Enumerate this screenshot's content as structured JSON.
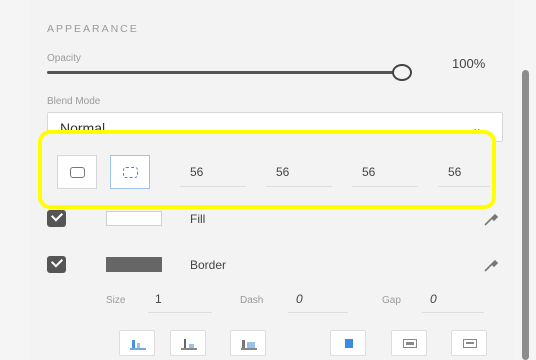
{
  "appearance": {
    "section_title": "APPEARANCE",
    "opacity": {
      "label": "Opacity",
      "value_text": "100%",
      "value": 1.0
    },
    "blend_mode": {
      "label": "Blend Mode",
      "selected": "Normal"
    },
    "corner_radius": {
      "modes": [
        "uniform-corners",
        "individual-corners"
      ],
      "active_mode": "individual-corners",
      "values": [
        "56",
        "56",
        "56",
        "56"
      ]
    },
    "fill": {
      "label": "Fill",
      "checked": true,
      "color": "#ffffff"
    },
    "border": {
      "label": "Border",
      "checked": true,
      "color": "#666666",
      "size_label": "Size",
      "size_value": "1",
      "dash_label": "Dash",
      "dash_value": "0",
      "gap_label": "Gap",
      "gap_value": "0"
    },
    "alignment_buttons": [
      "align-bottom-left-icon",
      "align-bottom-center-icon",
      "align-bottom-right-icon",
      "border-inside-icon",
      "border-center-icon",
      "border-outside-icon"
    ]
  },
  "colors": {
    "highlight": "#ffff00",
    "accent": "#3b8be0"
  }
}
